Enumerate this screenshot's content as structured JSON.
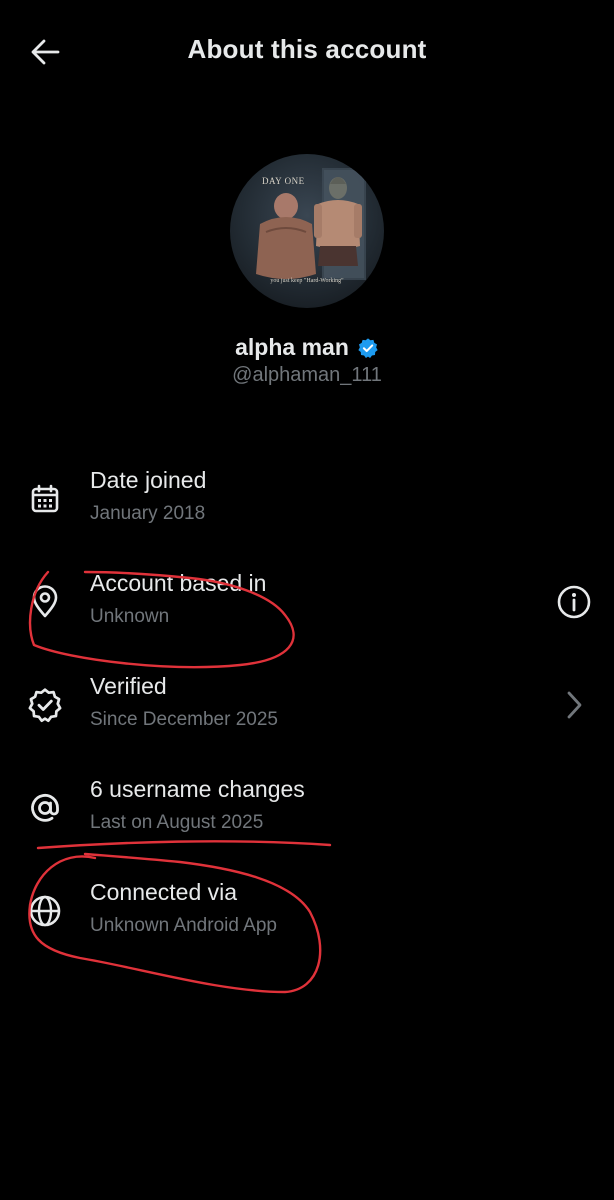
{
  "header": {
    "title": "About this account",
    "back_icon": "arrow-left-icon"
  },
  "profile": {
    "display_name": "alpha man",
    "username": "@alphaman_111",
    "verified_color": "#1d9bf0",
    "avatar_caption_top": "DAY ONE",
    "avatar_caption_bottom": "you just keep \"Hard-Working\""
  },
  "rows": [
    {
      "title": "Date joined",
      "value": "January 2018",
      "icon": "calendar-icon"
    },
    {
      "title": "Account based in",
      "value": "Unknown",
      "icon": "location-pin-icon",
      "trailing_icon": "info-icon"
    },
    {
      "title": "Verified",
      "value": "Since December 2025",
      "icon": "verified-check-icon",
      "trailing_icon": "chevron-right-icon"
    },
    {
      "title": "6 username changes",
      "value": "Last on August 2025",
      "icon": "at-sign-icon"
    },
    {
      "title": "Connected via",
      "value": "Unknown Android App",
      "icon": "globe-icon"
    }
  ],
  "colors": {
    "background": "#000000",
    "primary_text": "#e7e9ea",
    "secondary_text": "#71767b",
    "annotation_red": "#e0323a"
  }
}
